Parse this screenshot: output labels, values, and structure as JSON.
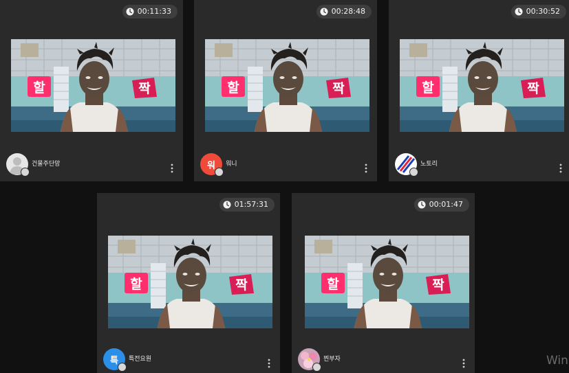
{
  "colors": {
    "background": "#111111",
    "tile": "#2a2a2a",
    "timer_pill": "#3e3e3e",
    "caption_pink": "#ff2f6d"
  },
  "icons": {
    "timer": "clock-icon",
    "menu": "more-vertical-icon",
    "avatar_badge": "play-badge-icon"
  },
  "video_caption": {
    "left": "할",
    "right": "짝"
  },
  "tiles": [
    {
      "timer": "00:11:33",
      "name": "건물주단망",
      "avatar_text": "",
      "avatar_color": "#e6e6e6"
    },
    {
      "timer": "00:28:48",
      "name": "워니",
      "avatar_text": "워",
      "avatar_color": "#f04a3a"
    },
    {
      "timer": "00:30:52",
      "name": "노토리",
      "avatar_text": "",
      "avatar_color": "#ffffff"
    },
    {
      "timer": "01:57:31",
      "name": "특전요원",
      "avatar_text": "특",
      "avatar_color": "#2b8fe8"
    },
    {
      "timer": "00:01:47",
      "name": "찐부자",
      "avatar_text": "",
      "avatar_color": "#c9a3b8"
    }
  ],
  "watermark": "Win"
}
